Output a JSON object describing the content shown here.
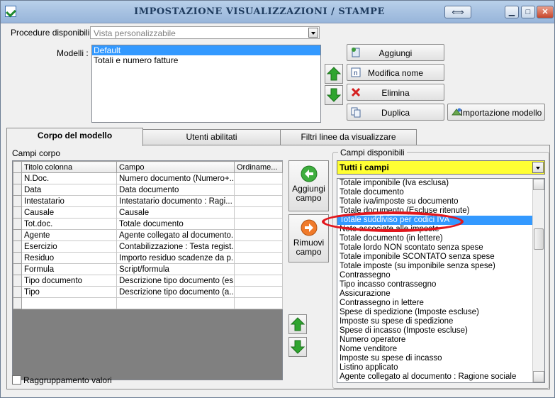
{
  "window": {
    "title": "IMPOSTAZIONE VISUALIZZAZIONI / STAMPE",
    "restore_label": "⟺",
    "min_label": "▁",
    "max_label": "□",
    "close_label": "✕"
  },
  "header": {
    "procedure_label": "Procedure disponibili :",
    "procedure_value": "Vista personalizzabile",
    "modelli_label": "Modelli :",
    "modelli": [
      {
        "label": "Default",
        "selected": true
      },
      {
        "label": "Totali e numero fatture",
        "selected": false
      }
    ],
    "buttons": {
      "aggiungi": "Aggiungi",
      "modifica_nome": "Modifica nome",
      "elimina": "Elimina",
      "duplica": "Duplica",
      "importazione": "Importazione modello"
    }
  },
  "tabs": [
    {
      "label": "Corpo del modello",
      "active": true
    },
    {
      "label": "Utenti abilitati",
      "active": false
    },
    {
      "label": "Filtri linee da visualizzare",
      "active": false
    }
  ],
  "corpo": {
    "section_label": "Campi corpo",
    "columns": [
      "Titolo colonna",
      "Campo",
      "Ordiname..."
    ],
    "rows": [
      [
        "N.Doc.",
        "Numero documento (Numero+...",
        ""
      ],
      [
        "Data",
        "Data documento",
        ""
      ],
      [
        "Intestatario",
        "Intestatario documento : Ragi...",
        ""
      ],
      [
        "Causale",
        "Causale",
        ""
      ],
      [
        "Tot.doc.",
        "Totale documento",
        ""
      ],
      [
        "Agente",
        "Agente collegato al documento...",
        ""
      ],
      [
        "Esercizio",
        "Contabilizzazione : Testa regist...",
        ""
      ],
      [
        "Residuo",
        "Importo residuo scadenze da p...",
        ""
      ],
      [
        "Formula",
        "Script/formula",
        ""
      ],
      [
        "Tipo documento",
        "Descrizione tipo documento (es...",
        ""
      ],
      [
        "Tipo",
        "Descrizione tipo documento (a...",
        ""
      ],
      [
        "",
        "",
        ""
      ]
    ],
    "aggiungi_campo": [
      "Aggiungi",
      "campo"
    ],
    "rimuovi_campo": [
      "Rimuovi",
      "campo"
    ],
    "raggruppamento_label": "Raggruppamento valori"
  },
  "disponibili": {
    "section_label": "Campi disponibili",
    "filter_value": "Tutti i campi",
    "items": [
      {
        "label": "Totale imponibile (Iva esclusa)",
        "selected": false
      },
      {
        "label": "Totale documento",
        "selected": false
      },
      {
        "label": "Totale iva/imposte su documento",
        "selected": false
      },
      {
        "label": "Totale documento (Escluse ritenute)",
        "selected": false
      },
      {
        "label": "Totale suddiviso per codici IVA",
        "selected": true
      },
      {
        "label": "Note associate alle imposte",
        "selected": false
      },
      {
        "label": "Totale documento (in lettere)",
        "selected": false
      },
      {
        "label": "Totale lordo NON scontato senza spese",
        "selected": false
      },
      {
        "label": "Totale imponibile SCONTATO senza spese",
        "selected": false
      },
      {
        "label": "Totale imposte (su imponibile senza spese)",
        "selected": false
      },
      {
        "label": "Contrassegno",
        "selected": false
      },
      {
        "label": "Tipo incasso contrassegno",
        "selected": false
      },
      {
        "label": "Assicurazione",
        "selected": false
      },
      {
        "label": "Contrassegno in lettere",
        "selected": false
      },
      {
        "label": "Spese di spedizione (Imposte escluse)",
        "selected": false
      },
      {
        "label": "Imposte su spese di spedizione",
        "selected": false
      },
      {
        "label": "Spese di incasso (Imposte escluse)",
        "selected": false
      },
      {
        "label": "Numero operatore",
        "selected": false
      },
      {
        "label": "Nome venditore",
        "selected": false
      },
      {
        "label": "Imposte su spese di incasso",
        "selected": false
      },
      {
        "label": "Listino applicato",
        "selected": false
      },
      {
        "label": "Agente collegato al documento : Ragione sociale",
        "selected": false
      }
    ]
  },
  "colors": {
    "selection": "#3399ff",
    "filter_bg": "#ffff33",
    "highlight_ring": "#e2171d",
    "arrow_green": "#2fa52f"
  }
}
